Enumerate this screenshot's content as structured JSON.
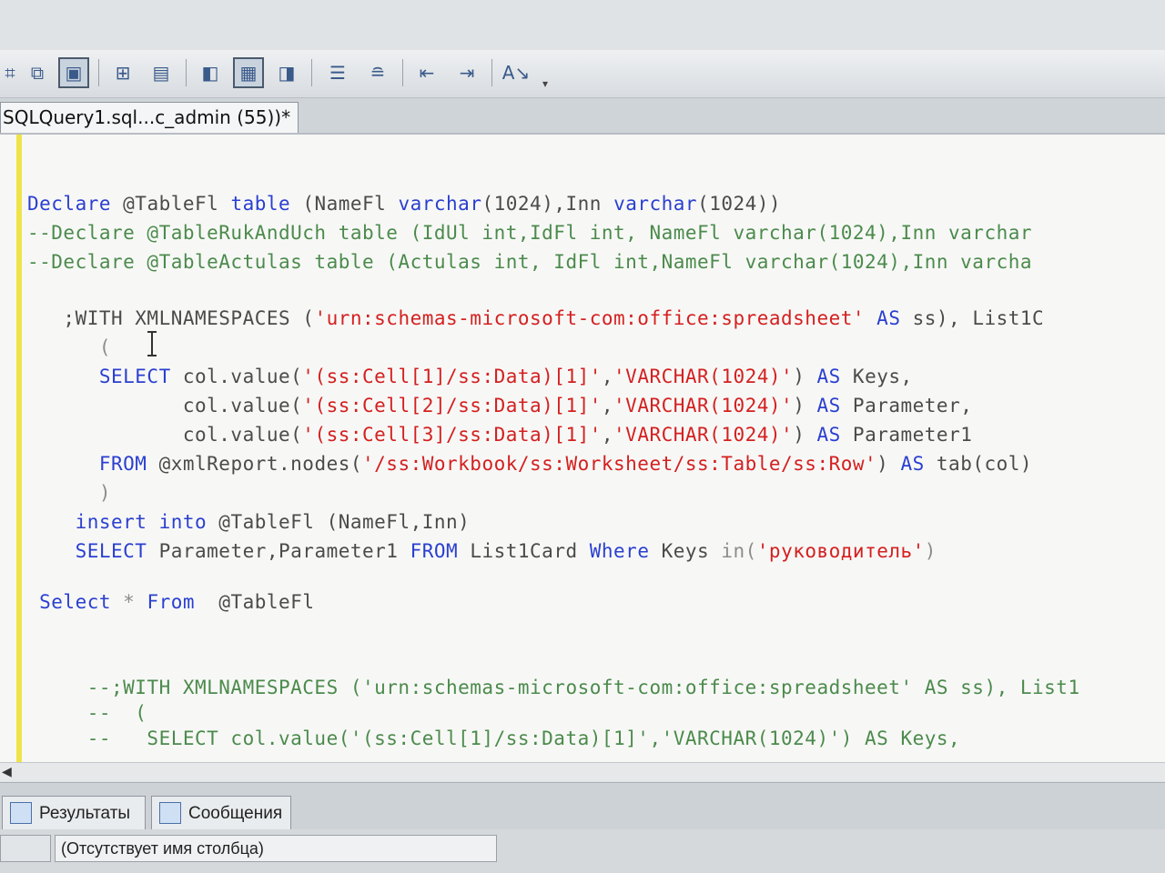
{
  "toolbar": {
    "icons": [
      "query-options-icon",
      "copy-icon",
      "save-icon",
      "results-to-text-icon",
      "results-to-grid-icon",
      "include-actual-plan-icon",
      "client-stats-icon",
      "display-estimated-plan-icon",
      "comment-lines-icon",
      "uncomment-lines-icon",
      "decrease-indent-icon",
      "increase-indent-icon",
      "specify-template-values-icon",
      "toolbar-options-icon"
    ]
  },
  "tab": {
    "title": "SQLQuery1.sql...c_admin (55))*"
  },
  "editor": {
    "lines": [
      [
        {
          "t": "Declare",
          "c": "kw"
        },
        {
          "t": " @TableFl ",
          "c": "pl"
        },
        {
          "t": "table",
          "c": "kw"
        },
        {
          "t": " (NameFl ",
          "c": "pl"
        },
        {
          "t": "varchar",
          "c": "kw"
        },
        {
          "t": "(1024),Inn ",
          "c": "pl"
        },
        {
          "t": "varchar",
          "c": "kw"
        },
        {
          "t": "(1024))",
          "c": "pl"
        }
      ],
      [
        {
          "t": "--Declare @TableRukAndUch table (IdUl int,IdFl int, NameFl varchar(1024),Inn varchar",
          "c": "cm"
        }
      ],
      [
        {
          "t": "--Declare @TableActulas table (Actulas int, IdFl int,NameFl varchar(1024),Inn varcha",
          "c": "cm"
        }
      ],
      [
        {
          "t": "   ;WITH XMLNAMESPACES (",
          "c": "pl"
        },
        {
          "t": "'urn:schemas-microsoft-com:office:spreadsheet'",
          "c": "str"
        },
        {
          "t": " AS ",
          "c": "kw"
        },
        {
          "t": "ss), List1C",
          "c": "pl"
        }
      ],
      [
        {
          "t": "      (",
          "c": "gr"
        }
      ],
      [
        {
          "t": "      SELECT",
          "c": "kw"
        },
        {
          "t": " col.value(",
          "c": "pl"
        },
        {
          "t": "'(ss:Cell[1]/ss:Data)[1]'",
          "c": "str"
        },
        {
          "t": ",",
          "c": "pl"
        },
        {
          "t": "'VARCHAR(1024)'",
          "c": "str"
        },
        {
          "t": ") ",
          "c": "pl"
        },
        {
          "t": "AS",
          "c": "kw"
        },
        {
          "t": " Keys,",
          "c": "pl"
        }
      ],
      [
        {
          "t": "             col.value(",
          "c": "pl"
        },
        {
          "t": "'(ss:Cell[2]/ss:Data)[1]'",
          "c": "str"
        },
        {
          "t": ",",
          "c": "pl"
        },
        {
          "t": "'VARCHAR(1024)'",
          "c": "str"
        },
        {
          "t": ") ",
          "c": "pl"
        },
        {
          "t": "AS",
          "c": "kw"
        },
        {
          "t": " Parameter,",
          "c": "pl"
        }
      ],
      [
        {
          "t": "             col.value(",
          "c": "pl"
        },
        {
          "t": "'(ss:Cell[3]/ss:Data)[1]'",
          "c": "str"
        },
        {
          "t": ",",
          "c": "pl"
        },
        {
          "t": "'VARCHAR(1024)'",
          "c": "str"
        },
        {
          "t": ") ",
          "c": "pl"
        },
        {
          "t": "AS",
          "c": "kw"
        },
        {
          "t": " Parameter1",
          "c": "pl"
        }
      ],
      [
        {
          "t": "      FROM",
          "c": "kw"
        },
        {
          "t": " @xmlReport.nodes(",
          "c": "pl"
        },
        {
          "t": "'/ss:Workbook/ss:Worksheet/ss:Table/ss:Row'",
          "c": "str"
        },
        {
          "t": ") ",
          "c": "pl"
        },
        {
          "t": "AS",
          "c": "kw"
        },
        {
          "t": " tab(col)",
          "c": "pl"
        }
      ],
      [
        {
          "t": "      )",
          "c": "gr"
        }
      ],
      [
        {
          "t": "    insert into",
          "c": "kw"
        },
        {
          "t": " @TableFl (NameFl,Inn)",
          "c": "pl"
        }
      ],
      [
        {
          "t": "    SELECT",
          "c": "kw"
        },
        {
          "t": " Parameter,Parameter1 ",
          "c": "pl"
        },
        {
          "t": "FROM",
          "c": "kw"
        },
        {
          "t": " List1Card ",
          "c": "pl"
        },
        {
          "t": "Where",
          "c": "kw"
        },
        {
          "t": " Keys ",
          "c": "pl"
        },
        {
          "t": "in",
          "c": "gr"
        },
        {
          "t": "(",
          "c": "gr"
        },
        {
          "t": "'руководитель'",
          "c": "str"
        },
        {
          "t": ")",
          "c": "gr"
        }
      ],
      [
        {
          "t": "",
          "c": "pl"
        }
      ],
      [
        {
          "t": " Select",
          "c": "kw"
        },
        {
          "t": " * ",
          "c": "gr"
        },
        {
          "t": "From",
          "c": "kw"
        },
        {
          "t": "  @TableFl",
          "c": "pl"
        }
      ],
      [
        {
          "t": "",
          "c": "pl"
        }
      ],
      [
        {
          "t": "",
          "c": "pl"
        }
      ],
      [
        {
          "t": "     --;WITH XMLNAMESPACES ('urn:schemas-microsoft-com:office:spreadsheet' AS ss), List1",
          "c": "cm"
        }
      ],
      [
        {
          "t": "     --  (",
          "c": "cm"
        }
      ],
      [
        {
          "t": "     --   SELECT col.value('(ss:Cell[1]/ss:Data)[1]','VARCHAR(1024)') AS Keys,",
          "c": "cm"
        }
      ]
    ]
  },
  "results": {
    "tabs": [
      "Результаты",
      "Сообщения"
    ],
    "column_header": "(Отсутствует имя столбца)"
  }
}
